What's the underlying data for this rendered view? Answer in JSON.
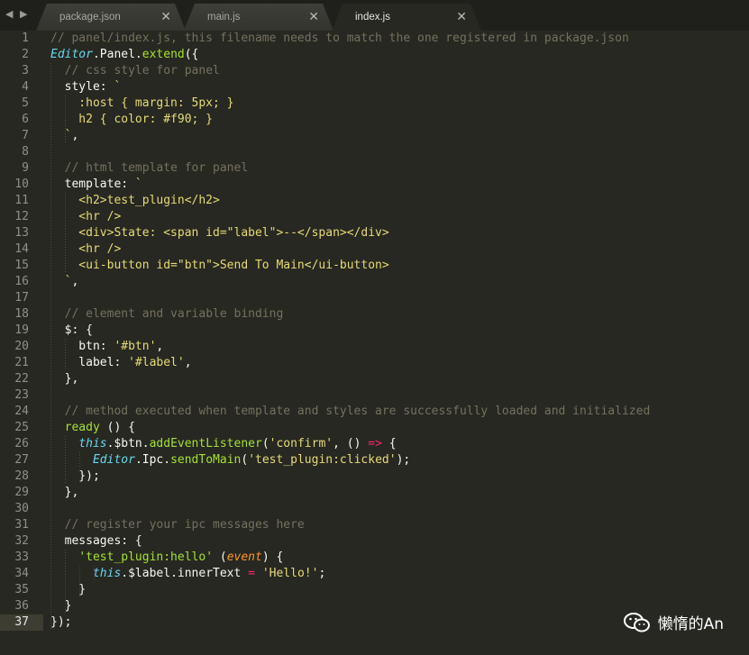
{
  "nav": {
    "arrows": "◀ ▶"
  },
  "tabs": [
    {
      "label": "package.json",
      "close": "✕"
    },
    {
      "label": "main.js",
      "close": "✕"
    },
    {
      "label": "index.js",
      "close": "✕"
    }
  ],
  "gutter": {
    "line_numbers": [
      "1",
      "2",
      "3",
      "4",
      "5",
      "6",
      "7",
      "8",
      "9",
      "10",
      "11",
      "12",
      "13",
      "14",
      "15",
      "16",
      "17",
      "18",
      "19",
      "20",
      "21",
      "22",
      "23",
      "24",
      "25",
      "26",
      "27",
      "28",
      "29",
      "30",
      "31",
      "32",
      "33",
      "34",
      "35",
      "36",
      "37"
    ],
    "current": "37"
  },
  "editor": {
    "lines": [
      [
        [
          "c",
          "// panel/index.js, this filename needs to match the one registered in package.json"
        ]
      ],
      [
        [
          "t",
          "Editor"
        ],
        [
          "p",
          ".Panel."
        ],
        [
          "f",
          "extend"
        ],
        [
          "p",
          "({"
        ]
      ],
      [
        [
          "p",
          "  "
        ],
        [
          "c",
          "// css style for panel"
        ]
      ],
      [
        [
          "p",
          "  style: "
        ],
        [
          "s",
          "`"
        ]
      ],
      [
        [
          "s",
          "    :host { margin: 5px; }"
        ]
      ],
      [
        [
          "s",
          "    h2 { color: #f90; }"
        ]
      ],
      [
        [
          "s",
          "  `"
        ],
        [
          "p",
          ","
        ]
      ],
      [
        [
          "p",
          ""
        ]
      ],
      [
        [
          "p",
          "  "
        ],
        [
          "c",
          "// html template for panel"
        ]
      ],
      [
        [
          "p",
          "  template: "
        ],
        [
          "s",
          "`"
        ]
      ],
      [
        [
          "s",
          "    <h2>test_plugin</h2>"
        ]
      ],
      [
        [
          "s",
          "    <hr />"
        ]
      ],
      [
        [
          "s",
          "    <div>State: <span id=\"label\">--</span></div>"
        ]
      ],
      [
        [
          "s",
          "    <hr />"
        ]
      ],
      [
        [
          "s",
          "    <ui-button id=\"btn\">Send To Main</ui-button>"
        ]
      ],
      [
        [
          "s",
          "  `"
        ],
        [
          "p",
          ","
        ]
      ],
      [
        [
          "p",
          ""
        ]
      ],
      [
        [
          "p",
          "  "
        ],
        [
          "c",
          "// element and variable binding"
        ]
      ],
      [
        [
          "p",
          "  $: {"
        ]
      ],
      [
        [
          "p",
          "    btn: "
        ],
        [
          "s",
          "'#btn'"
        ],
        [
          "p",
          ","
        ]
      ],
      [
        [
          "p",
          "    label: "
        ],
        [
          "s",
          "'#label'"
        ],
        [
          "p",
          ","
        ]
      ],
      [
        [
          "p",
          "  },"
        ]
      ],
      [
        [
          "p",
          ""
        ]
      ],
      [
        [
          "p",
          "  "
        ],
        [
          "c",
          "// method executed when template and styles are successfully loaded and initialized"
        ]
      ],
      [
        [
          "p",
          "  "
        ],
        [
          "f",
          "ready"
        ],
        [
          "p",
          " () {"
        ]
      ],
      [
        [
          "p",
          "    "
        ],
        [
          "t",
          "this"
        ],
        [
          "p",
          ".$btn."
        ],
        [
          "f",
          "addEventListener"
        ],
        [
          "p",
          "("
        ],
        [
          "s",
          "'confirm'"
        ],
        [
          "p",
          ", () "
        ],
        [
          "k",
          "=>"
        ],
        [
          "p",
          " {"
        ]
      ],
      [
        [
          "p",
          "      "
        ],
        [
          "t",
          "Editor"
        ],
        [
          "p",
          ".Ipc."
        ],
        [
          "f",
          "sendToMain"
        ],
        [
          "p",
          "("
        ],
        [
          "s",
          "'test_plugin:clicked'"
        ],
        [
          "p",
          ");"
        ]
      ],
      [
        [
          "p",
          "    });"
        ]
      ],
      [
        [
          "p",
          "  },"
        ]
      ],
      [
        [
          "p",
          ""
        ]
      ],
      [
        [
          "p",
          "  "
        ],
        [
          "c",
          "// register your ipc messages here"
        ]
      ],
      [
        [
          "p",
          "  messages: {"
        ]
      ],
      [
        [
          "p",
          "    "
        ],
        [
          "f",
          "'test_plugin:hello'"
        ],
        [
          "p",
          " ("
        ],
        [
          "v",
          "event"
        ],
        [
          "p",
          ") {"
        ]
      ],
      [
        [
          "p",
          "      "
        ],
        [
          "t",
          "this"
        ],
        [
          "p",
          ".$label.innerText "
        ],
        [
          "k",
          "="
        ],
        [
          "p",
          " "
        ],
        [
          "s",
          "'Hello!'"
        ],
        [
          "p",
          ";"
        ]
      ],
      [
        [
          "p",
          "    }"
        ]
      ],
      [
        [
          "p",
          "  }"
        ]
      ],
      [
        [
          "p",
          "});"
        ]
      ]
    ]
  },
  "watermark": {
    "text": "懒惰的An",
    "icon": "wechat-icon"
  }
}
